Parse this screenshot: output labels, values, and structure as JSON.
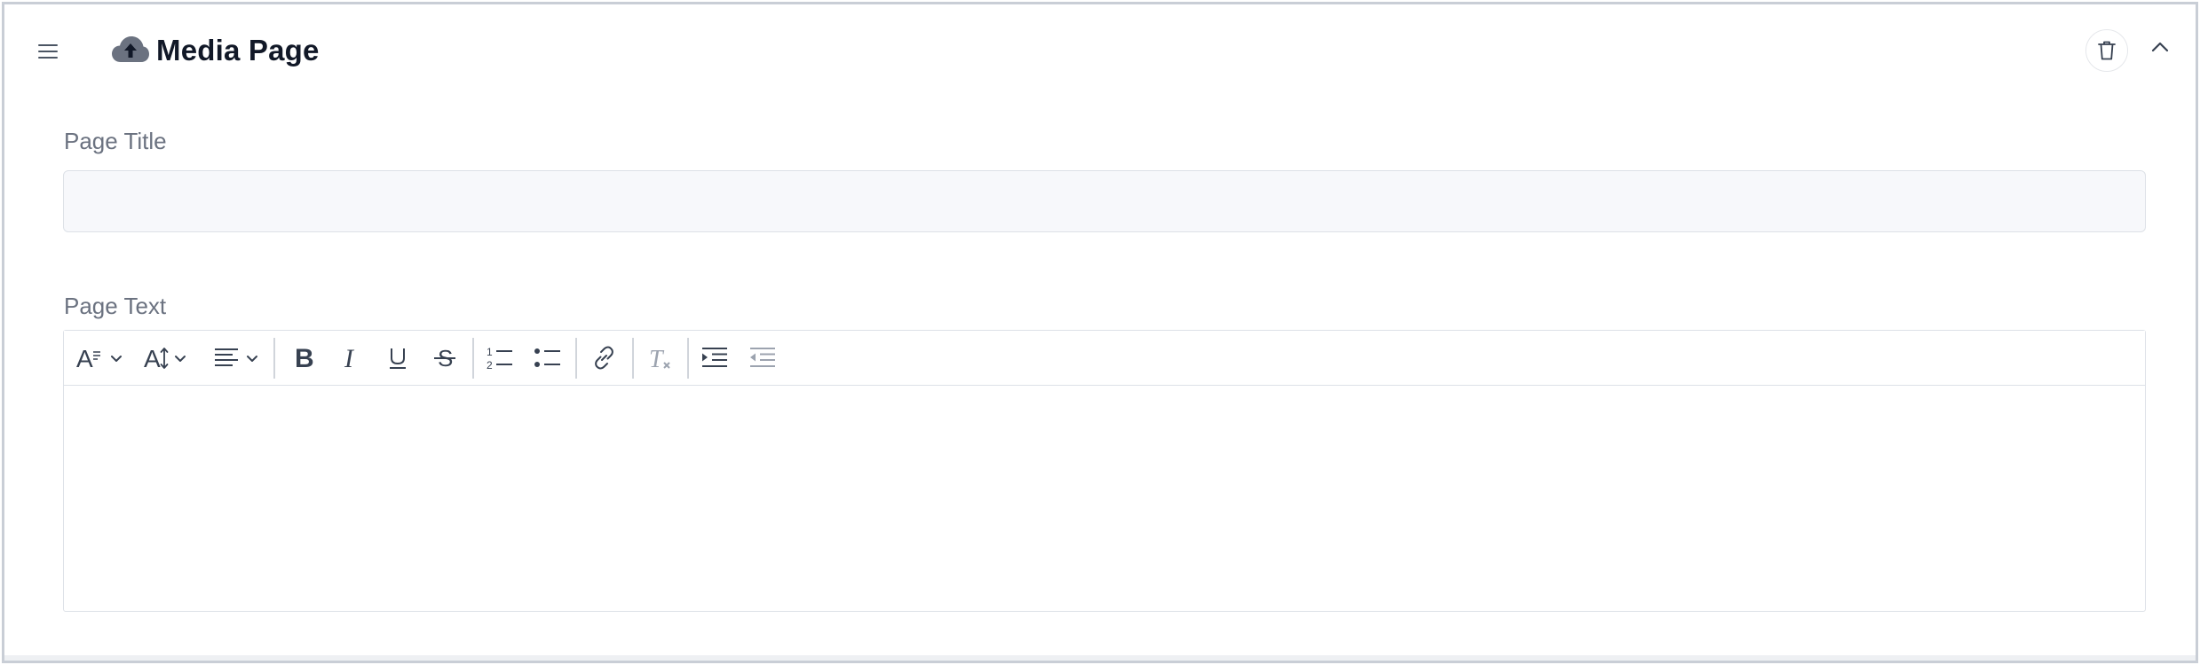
{
  "header": {
    "title": "Media Page",
    "icon": "cloud-upload-icon"
  },
  "fields": {
    "page_title_label": "Page Title",
    "page_title_value": "",
    "page_text_label": "Page Text",
    "page_text_value": ""
  },
  "toolbar": {
    "items": [
      "font-style",
      "font-size",
      "align",
      "bold",
      "italic",
      "underline",
      "strikethrough",
      "ordered-list",
      "bullet-list",
      "link",
      "clear-formatting",
      "indent",
      "outdent"
    ]
  },
  "colors": {
    "icon": "#374151",
    "disabled_icon": "#9ca3af",
    "border": "#dde1e7",
    "input_bg": "#f7f8fb"
  }
}
